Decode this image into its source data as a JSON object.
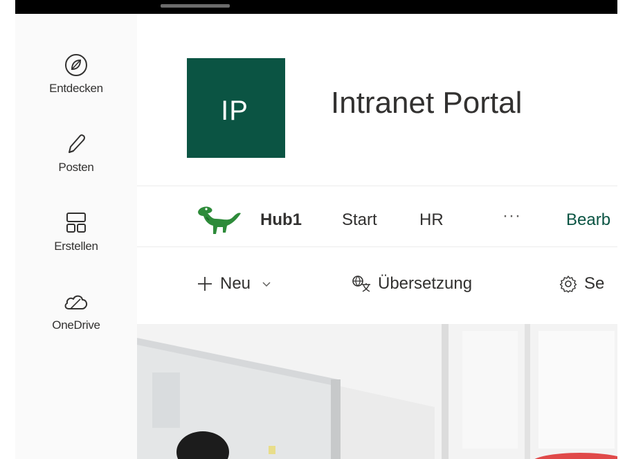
{
  "appbar": {
    "items": [
      {
        "label": "Entdecken",
        "icon": "compass-icon"
      },
      {
        "label": "Posten",
        "icon": "pen-icon"
      },
      {
        "label": "Erstellen",
        "icon": "layout-icon"
      },
      {
        "label": "OneDrive",
        "icon": "cloud-icon"
      }
    ]
  },
  "site": {
    "logo_text": "IP",
    "logo_color": "#0b5443",
    "title": "Intranet Portal"
  },
  "hubnav": {
    "hub_name": "Hub1",
    "hub_icon": "dinosaur-icon",
    "links": [
      "Start",
      "HR"
    ],
    "more": "···",
    "edit_label": "Bearb"
  },
  "commandbar": {
    "new_label": "Neu",
    "translate_label": "Übersetzung",
    "settings_label": "Se"
  },
  "colors": {
    "accent": "#0b5443",
    "hub_green": "#2e8b3a"
  }
}
